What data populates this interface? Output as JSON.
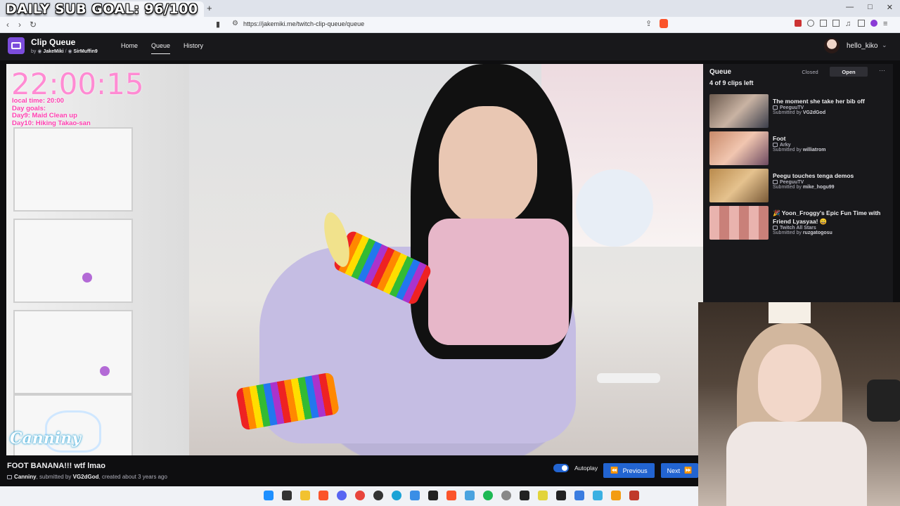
{
  "overlay": {
    "sub_goal": "DAILY SUB GOAL: 96/100"
  },
  "browser": {
    "url": "https://jakemiki.me/twitch-clip-queue/queue",
    "tab_close": "×",
    "new_tab": "+",
    "back": "‹",
    "forward": "›",
    "reload": "↻"
  },
  "app": {
    "title": "Clip Queue",
    "by_prefix": "by",
    "author1": "JakeMiki",
    "sep": "/",
    "author2": "SirMuffin9",
    "nav": [
      {
        "label": "Home"
      },
      {
        "label": "Queue"
      },
      {
        "label": "History"
      }
    ],
    "user": "hello_kiko"
  },
  "stream_overlay": {
    "time": "22:00:15",
    "lines": [
      "local time: 20:00",
      "Day goals:",
      "Day9: Maid Clean up",
      "Day10: Hiking Takao-san"
    ],
    "logo": "Canniny"
  },
  "current_clip": {
    "title": "FOOT BANANA!!! wtf lmao",
    "channel": "Canniny",
    "submitted_by_prefix": ", submitted by",
    "submitter": "VG2dGod",
    "created": ", created about 3 years ago"
  },
  "controls": {
    "autoplay_label": "Autoplay",
    "autoplay_on": true,
    "previous_label": "Previous",
    "next_label": "Next"
  },
  "queue": {
    "title": "Queue",
    "closed_label": "Closed",
    "open_label": "Open",
    "more": "···",
    "count_text": "4 of 9 clips left",
    "items": [
      {
        "title": "The moment she take her bib off",
        "channel": "PeeguuTV",
        "submitted_prefix": "Submitted by",
        "submitter": "VG2dGod"
      },
      {
        "title": "Foot",
        "channel": "Arky",
        "submitted_prefix": "Submitted by",
        "submitter": "williatrom"
      },
      {
        "title": "Peegu touches tenga demos",
        "channel": "PeeguuTV",
        "submitted_prefix": "Submitted by",
        "submitter": "mike_hogu99"
      },
      {
        "title": "🎉 Yoon_Froggy's Epic Fun Time with Friend Lyasyaa! 😄",
        "channel": "Twitch All Stars",
        "submitted_prefix": "Submitted by",
        "submitter": "ruzgatogosu"
      }
    ]
  },
  "colors": {
    "accent": "#2264d1",
    "logo_bg": "#7c4ddc",
    "panel_bg": "#18181b",
    "page_bg": "#0e0e10",
    "overlay_pink": "#ff8bd3"
  },
  "icons": {
    "logo": "tv-icon",
    "author": "github-icon",
    "channel": "twitch-icon",
    "prev": "double-chevron-left-icon",
    "next": "double-chevron-right-icon"
  }
}
